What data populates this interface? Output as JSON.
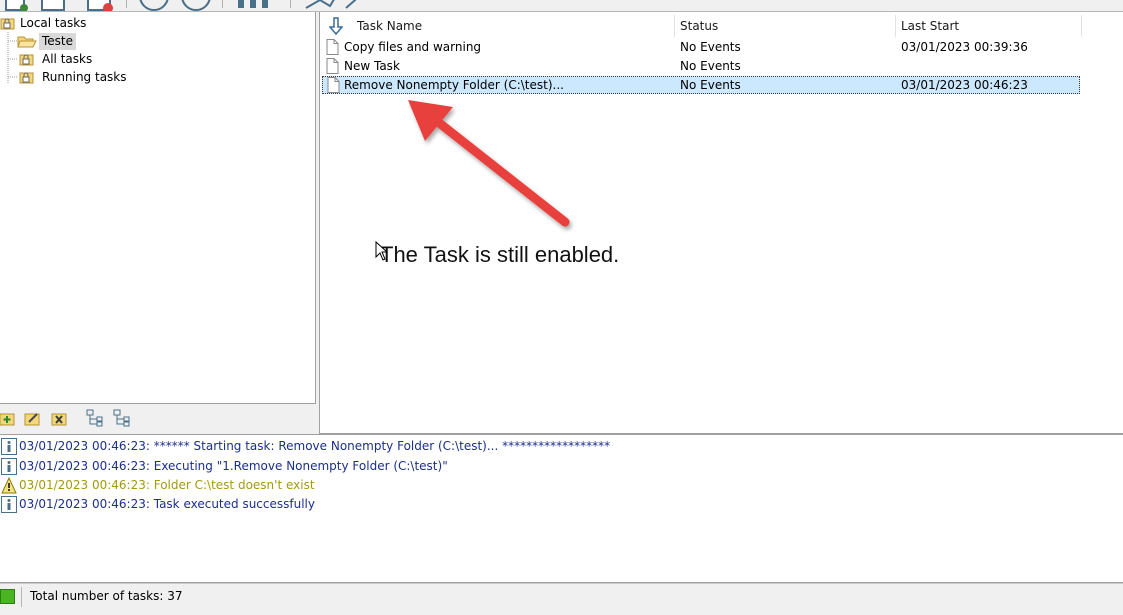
{
  "tree": {
    "root": {
      "label": "Local tasks",
      "icon": "lock-folder-icon"
    },
    "items": [
      {
        "label": "Teste",
        "icon": "open-folder-icon",
        "selected": true
      },
      {
        "label": "All tasks",
        "icon": "lock-folder-icon",
        "selected": false
      },
      {
        "label": "Running tasks",
        "icon": "lock-folder-icon",
        "selected": false
      }
    ]
  },
  "list": {
    "sort_icon": "sort-down-arrow-icon",
    "columns": [
      "Task Name",
      "Status",
      "Last Start"
    ],
    "rows": [
      {
        "name": "Copy files and warning",
        "status": "No Events",
        "last_start": "03/01/2023 00:39:36",
        "selected": false
      },
      {
        "name": "New Task",
        "status": "No Events",
        "last_start": "",
        "selected": false
      },
      {
        "name": "Remove Nonempty Folder  (C:\\test)...",
        "status": "No Events",
        "last_start": "03/01/2023 00:46:23",
        "selected": true
      }
    ]
  },
  "annotation": {
    "text": "The Task is still enabled.",
    "arrow_color": "#e8413c"
  },
  "log": [
    {
      "type": "info",
      "text": "03/01/2023 00:46:23: ****** Starting task: Remove Nonempty Folder  (C:\\test)... ******************"
    },
    {
      "type": "info",
      "text": "03/01/2023 00:46:23: Executing \"1.Remove Nonempty Folder  (C:\\test)\""
    },
    {
      "type": "warning",
      "text": "03/01/2023 00:46:23: Folder C:\\test doesn't exist"
    },
    {
      "type": "info",
      "text": "03/01/2023 00:46:23: Task executed successfully"
    }
  ],
  "status_bar": {
    "text": "Total number of tasks: 37",
    "led_color": "#4ab522"
  },
  "colors": {
    "info_text": "#1c2f8a",
    "warning_text": "#a29a10",
    "selection": "#cce8ff"
  }
}
